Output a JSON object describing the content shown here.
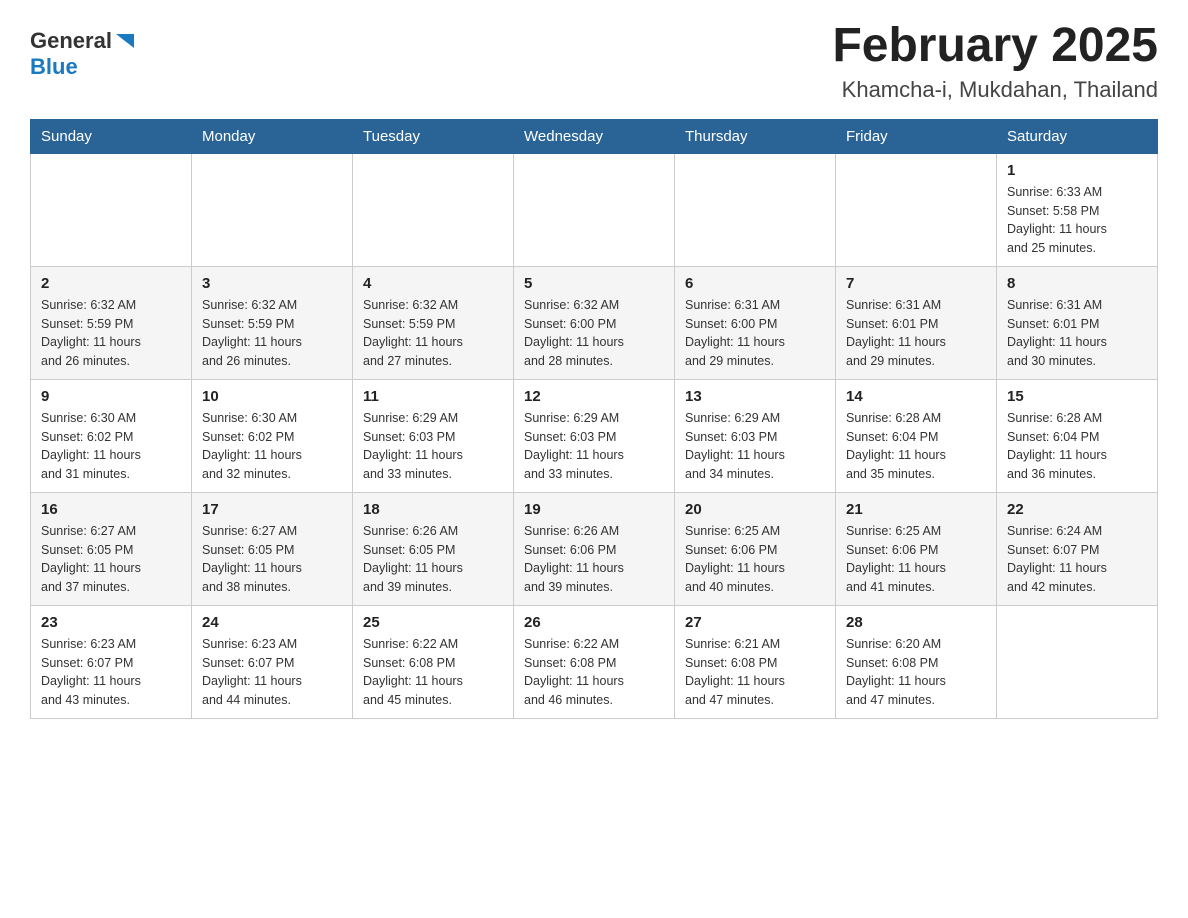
{
  "header": {
    "logo_general": "General",
    "logo_blue": "Blue",
    "month_title": "February 2025",
    "location": "Khamcha-i, Mukdahan, Thailand"
  },
  "weekdays": [
    "Sunday",
    "Monday",
    "Tuesday",
    "Wednesday",
    "Thursday",
    "Friday",
    "Saturday"
  ],
  "weeks": [
    {
      "days": [
        {
          "number": "",
          "info": ""
        },
        {
          "number": "",
          "info": ""
        },
        {
          "number": "",
          "info": ""
        },
        {
          "number": "",
          "info": ""
        },
        {
          "number": "",
          "info": ""
        },
        {
          "number": "",
          "info": ""
        },
        {
          "number": "1",
          "info": "Sunrise: 6:33 AM\nSunset: 5:58 PM\nDaylight: 11 hours\nand 25 minutes."
        }
      ]
    },
    {
      "days": [
        {
          "number": "2",
          "info": "Sunrise: 6:32 AM\nSunset: 5:59 PM\nDaylight: 11 hours\nand 26 minutes."
        },
        {
          "number": "3",
          "info": "Sunrise: 6:32 AM\nSunset: 5:59 PM\nDaylight: 11 hours\nand 26 minutes."
        },
        {
          "number": "4",
          "info": "Sunrise: 6:32 AM\nSunset: 5:59 PM\nDaylight: 11 hours\nand 27 minutes."
        },
        {
          "number": "5",
          "info": "Sunrise: 6:32 AM\nSunset: 6:00 PM\nDaylight: 11 hours\nand 28 minutes."
        },
        {
          "number": "6",
          "info": "Sunrise: 6:31 AM\nSunset: 6:00 PM\nDaylight: 11 hours\nand 29 minutes."
        },
        {
          "number": "7",
          "info": "Sunrise: 6:31 AM\nSunset: 6:01 PM\nDaylight: 11 hours\nand 29 minutes."
        },
        {
          "number": "8",
          "info": "Sunrise: 6:31 AM\nSunset: 6:01 PM\nDaylight: 11 hours\nand 30 minutes."
        }
      ]
    },
    {
      "days": [
        {
          "number": "9",
          "info": "Sunrise: 6:30 AM\nSunset: 6:02 PM\nDaylight: 11 hours\nand 31 minutes."
        },
        {
          "number": "10",
          "info": "Sunrise: 6:30 AM\nSunset: 6:02 PM\nDaylight: 11 hours\nand 32 minutes."
        },
        {
          "number": "11",
          "info": "Sunrise: 6:29 AM\nSunset: 6:03 PM\nDaylight: 11 hours\nand 33 minutes."
        },
        {
          "number": "12",
          "info": "Sunrise: 6:29 AM\nSunset: 6:03 PM\nDaylight: 11 hours\nand 33 minutes."
        },
        {
          "number": "13",
          "info": "Sunrise: 6:29 AM\nSunset: 6:03 PM\nDaylight: 11 hours\nand 34 minutes."
        },
        {
          "number": "14",
          "info": "Sunrise: 6:28 AM\nSunset: 6:04 PM\nDaylight: 11 hours\nand 35 minutes."
        },
        {
          "number": "15",
          "info": "Sunrise: 6:28 AM\nSunset: 6:04 PM\nDaylight: 11 hours\nand 36 minutes."
        }
      ]
    },
    {
      "days": [
        {
          "number": "16",
          "info": "Sunrise: 6:27 AM\nSunset: 6:05 PM\nDaylight: 11 hours\nand 37 minutes."
        },
        {
          "number": "17",
          "info": "Sunrise: 6:27 AM\nSunset: 6:05 PM\nDaylight: 11 hours\nand 38 minutes."
        },
        {
          "number": "18",
          "info": "Sunrise: 6:26 AM\nSunset: 6:05 PM\nDaylight: 11 hours\nand 39 minutes."
        },
        {
          "number": "19",
          "info": "Sunrise: 6:26 AM\nSunset: 6:06 PM\nDaylight: 11 hours\nand 39 minutes."
        },
        {
          "number": "20",
          "info": "Sunrise: 6:25 AM\nSunset: 6:06 PM\nDaylight: 11 hours\nand 40 minutes."
        },
        {
          "number": "21",
          "info": "Sunrise: 6:25 AM\nSunset: 6:06 PM\nDaylight: 11 hours\nand 41 minutes."
        },
        {
          "number": "22",
          "info": "Sunrise: 6:24 AM\nSunset: 6:07 PM\nDaylight: 11 hours\nand 42 minutes."
        }
      ]
    },
    {
      "days": [
        {
          "number": "23",
          "info": "Sunrise: 6:23 AM\nSunset: 6:07 PM\nDaylight: 11 hours\nand 43 minutes."
        },
        {
          "number": "24",
          "info": "Sunrise: 6:23 AM\nSunset: 6:07 PM\nDaylight: 11 hours\nand 44 minutes."
        },
        {
          "number": "25",
          "info": "Sunrise: 6:22 AM\nSunset: 6:08 PM\nDaylight: 11 hours\nand 45 minutes."
        },
        {
          "number": "26",
          "info": "Sunrise: 6:22 AM\nSunset: 6:08 PM\nDaylight: 11 hours\nand 46 minutes."
        },
        {
          "number": "27",
          "info": "Sunrise: 6:21 AM\nSunset: 6:08 PM\nDaylight: 11 hours\nand 47 minutes."
        },
        {
          "number": "28",
          "info": "Sunrise: 6:20 AM\nSunset: 6:08 PM\nDaylight: 11 hours\nand 47 minutes."
        },
        {
          "number": "",
          "info": ""
        }
      ]
    }
  ]
}
